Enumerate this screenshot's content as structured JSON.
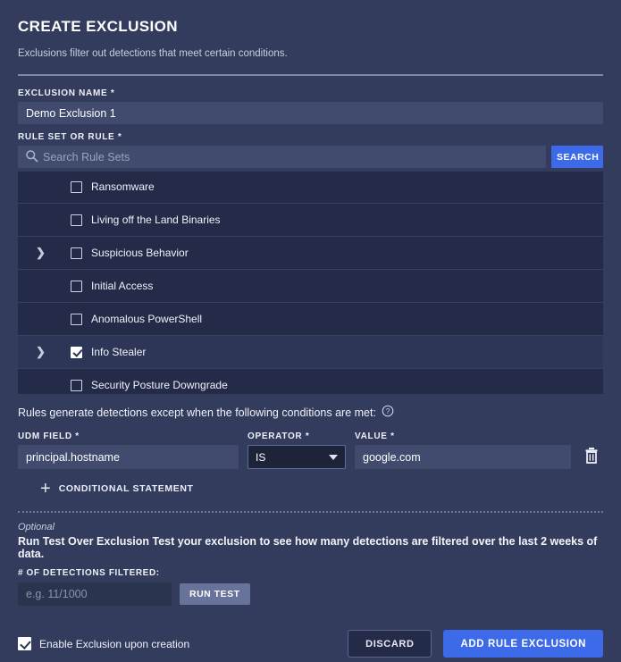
{
  "header": {
    "title": "CREATE EXCLUSION",
    "subtitle": "Exclusions filter out detections that meet certain conditions."
  },
  "exclusion_name": {
    "label": "EXCLUSION NAME *",
    "value": "Demo Exclusion 1"
  },
  "rule_set": {
    "label": "RULE SET OR RULE *",
    "search_placeholder": "Search Rule Sets",
    "search_value": "",
    "search_button": "SEARCH",
    "search_icon": "search-icon",
    "rows": [
      {
        "name": "Ransomware",
        "checked": false,
        "expandable": false,
        "highlight": false
      },
      {
        "name": "Living off the Land Binaries",
        "checked": false,
        "expandable": false,
        "highlight": false
      },
      {
        "name": "Suspicious Behavior",
        "checked": false,
        "expandable": true,
        "highlight": false
      },
      {
        "name": "Initial Access",
        "checked": false,
        "expandable": false,
        "highlight": false
      },
      {
        "name": "Anomalous PowerShell",
        "checked": false,
        "expandable": false,
        "highlight": false
      },
      {
        "name": "Info Stealer",
        "checked": true,
        "expandable": true,
        "highlight": true
      },
      {
        "name": "Security Posture Downgrade",
        "checked": false,
        "expandable": false,
        "highlight": false
      }
    ]
  },
  "conditions": {
    "heading": "Rules generate detections except when the following conditions are met:",
    "help_icon": "help-circle-icon",
    "udm_label": "UDM FIELD *",
    "operator_label": "OPERATOR *",
    "value_label": "VALUE *",
    "udm_value": "principal.hostname",
    "operator_value": "IS",
    "value_value": "google.com",
    "delete_icon": "trash-icon",
    "add_label": "CONDITIONAL STATEMENT",
    "add_icon": "plus-icon"
  },
  "test": {
    "optional_label": "Optional",
    "description": "Run Test Over Exclusion Test your exclusion to see how many detections are filtered over the last 2 weeks of data.",
    "detections_label": "# OF DETECTIONS FILTERED:",
    "detections_placeholder": "e.g. 11/1000",
    "detections_value": "",
    "run_test_button": "RUN TEST"
  },
  "footer": {
    "enable_label": "Enable Exclusion upon creation",
    "enable_checked": true,
    "discard_button": "DISCARD",
    "submit_button": "ADD RULE EXCLUSION"
  },
  "colors": {
    "page_background": "#333c5c",
    "accent_blue": "#3d6ae8",
    "list_background": "#232b49",
    "input_background": "#414b6e"
  }
}
